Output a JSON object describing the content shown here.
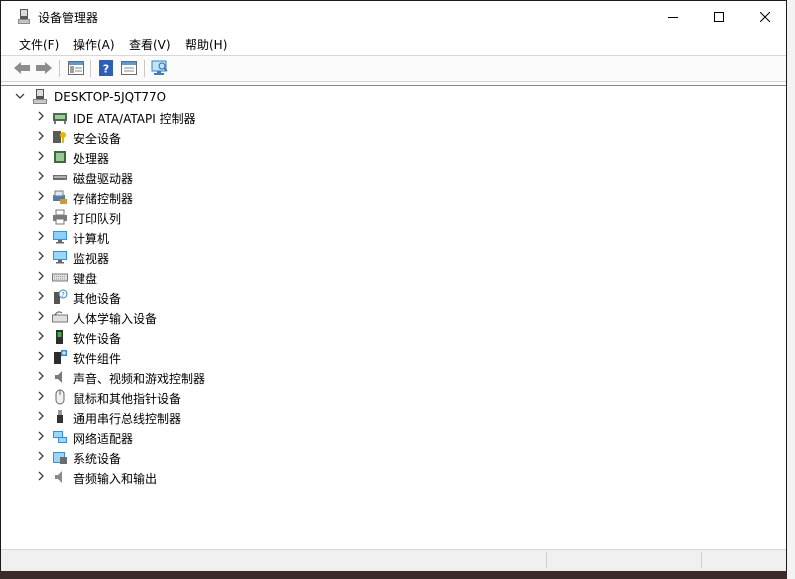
{
  "window": {
    "title": "设备管理器"
  },
  "menu": [
    {
      "label": "文件(F)"
    },
    {
      "label": "操作(A)"
    },
    {
      "label": "查看(V)"
    },
    {
      "label": "帮助(H)"
    }
  ],
  "toolbar": {
    "buttons": [
      "back-icon",
      "forward-icon",
      "show-hide-console-tree-icon",
      "help-icon",
      "properties-icon",
      "scan-hardware-icon"
    ]
  },
  "tree": {
    "root": {
      "label": "DESKTOP-5JQT77O",
      "icon": "computer-tower-icon"
    },
    "items": [
      {
        "label": "IDE ATA/ATAPI 控制器",
        "icon": "ide-controller-icon"
      },
      {
        "label": "安全设备",
        "icon": "security-device-icon"
      },
      {
        "label": "处理器",
        "icon": "processor-icon"
      },
      {
        "label": "磁盘驱动器",
        "icon": "disk-drive-icon"
      },
      {
        "label": "存储控制器",
        "icon": "storage-controller-icon"
      },
      {
        "label": "打印队列",
        "icon": "printer-icon"
      },
      {
        "label": "计算机",
        "icon": "computer-icon"
      },
      {
        "label": "监视器",
        "icon": "monitor-icon"
      },
      {
        "label": "键盘",
        "icon": "keyboard-icon"
      },
      {
        "label": "其他设备",
        "icon": "unknown-device-icon"
      },
      {
        "label": "人体学输入设备",
        "icon": "hid-icon"
      },
      {
        "label": "软件设备",
        "icon": "software-device-icon"
      },
      {
        "label": "软件组件",
        "icon": "software-component-icon"
      },
      {
        "label": "声音、视频和游戏控制器",
        "icon": "speaker-icon"
      },
      {
        "label": "鼠标和其他指针设备",
        "icon": "mouse-icon"
      },
      {
        "label": "通用串行总线控制器",
        "icon": "usb-icon"
      },
      {
        "label": "网络适配器",
        "icon": "network-adapter-icon"
      },
      {
        "label": "系统设备",
        "icon": "system-device-icon"
      },
      {
        "label": "音频输入和输出",
        "icon": "audio-io-icon"
      }
    ]
  },
  "colors": {
    "accent": "#0078d7",
    "tree_border": "#828790"
  }
}
